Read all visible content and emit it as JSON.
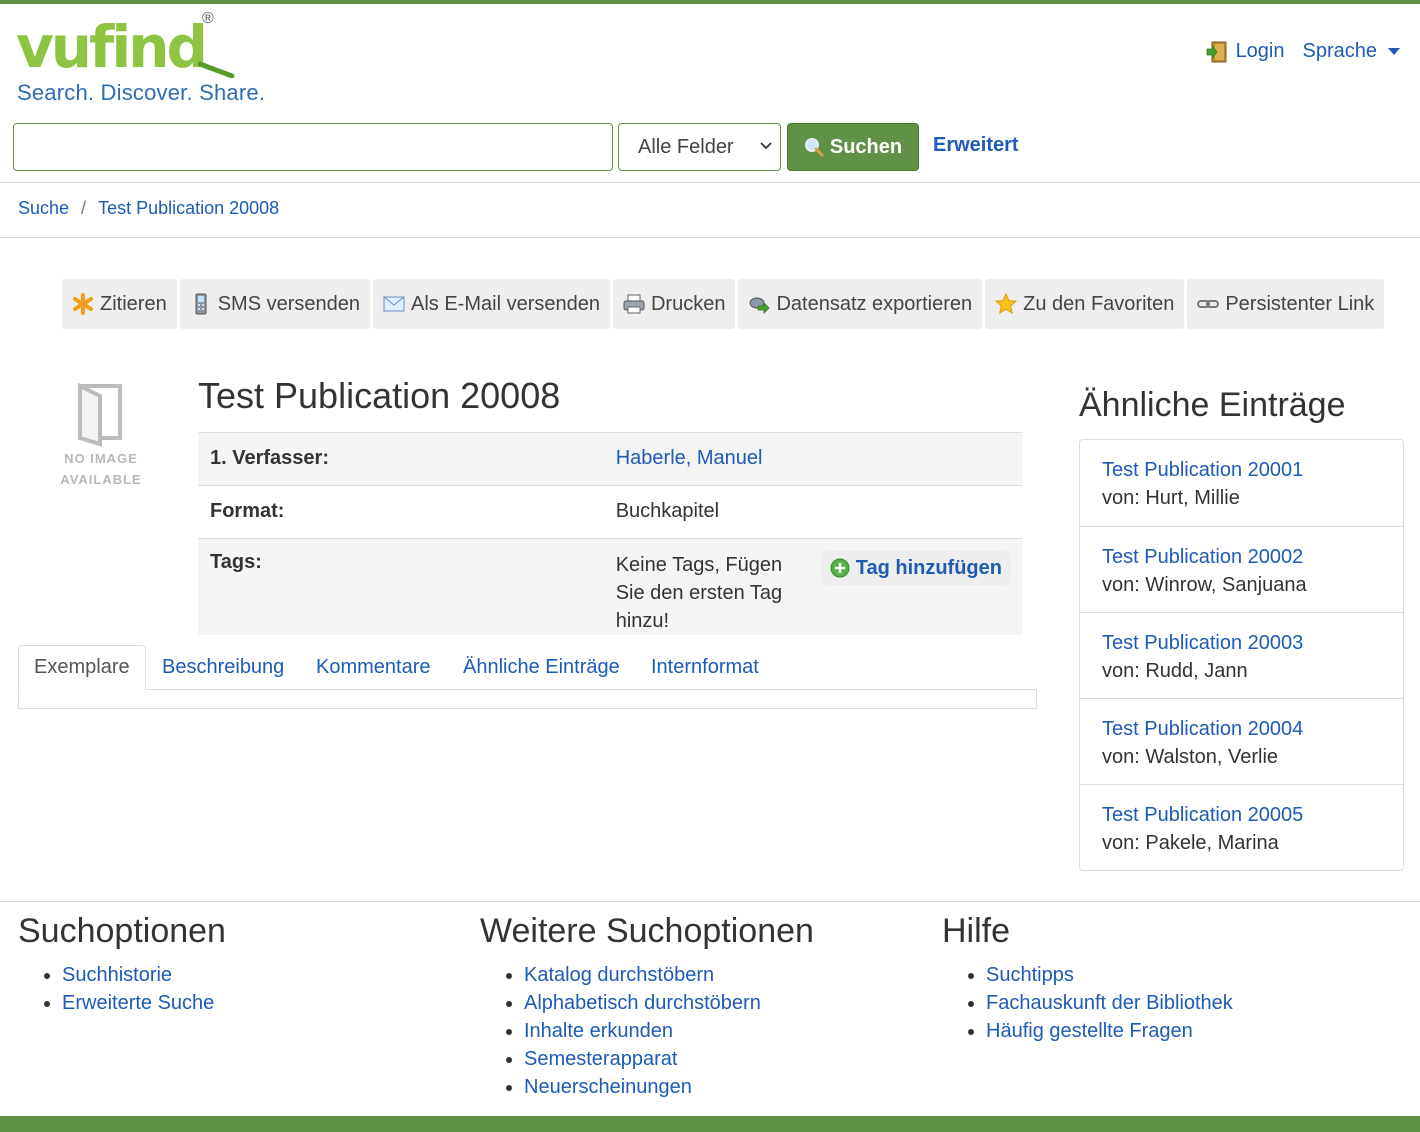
{
  "header": {
    "logo_word": "vufind",
    "logo_reg": "®",
    "logo_tagline": "Search. Discover. Share.",
    "login_label": "Login",
    "language_label": "Sprache"
  },
  "search": {
    "query": "",
    "field_selected": "Alle Felder",
    "submit_label": "Suchen",
    "advanced_label": "Erweitert"
  },
  "breadcrumb": {
    "items": [
      "Suche",
      "Test Publication 20008"
    ],
    "separator": "/"
  },
  "toolbar": {
    "items": [
      {
        "label": "Zitieren",
        "icon": "asterisk-icon"
      },
      {
        "label": "SMS versenden",
        "icon": "phone-icon"
      },
      {
        "label": "Als E-Mail versenden",
        "icon": "envelope-icon"
      },
      {
        "label": "Drucken",
        "icon": "printer-icon"
      },
      {
        "label": "Datensatz exportieren",
        "icon": "export-icon"
      },
      {
        "label": "Zu den Favoriten",
        "icon": "star-icon"
      },
      {
        "label": "Persistenter Link",
        "icon": "link-icon"
      }
    ]
  },
  "record": {
    "no_image_line1": "NO IMAGE",
    "no_image_line2": "AVAILABLE",
    "title": "Test Publication 20008",
    "fields": {
      "author_label": "1. Verfasser:",
      "author_value": "Haberle, Manuel",
      "format_label": "Format:",
      "format_value": "Buchkapitel",
      "tags_label": "Tags:",
      "tags_value": "Keine Tags, Fügen Sie den ersten Tag hinzu!",
      "add_tag_label": "Tag hinzufügen"
    }
  },
  "tabs": [
    {
      "label": "Exemplare",
      "active": true
    },
    {
      "label": "Beschreibung",
      "active": false
    },
    {
      "label": "Kommentare",
      "active": false
    },
    {
      "label": "Ähnliche Einträge",
      "active": false
    },
    {
      "label": "Internformat",
      "active": false
    }
  ],
  "similar": {
    "title": "Ähnliche Einträge",
    "items": [
      {
        "title": "Test Publication 20001",
        "by": "von: Hurt, Millie"
      },
      {
        "title": "Test Publication 20002",
        "by": "von: Winrow, Sanjuana"
      },
      {
        "title": "Test Publication 20003",
        "by": "von: Rudd, Jann"
      },
      {
        "title": "Test Publication 20004",
        "by": "von: Walston, Verlie"
      },
      {
        "title": "Test Publication 20005",
        "by": "von: Pakele, Marina"
      }
    ]
  },
  "footer": {
    "columns": [
      {
        "title": "Suchoptionen",
        "links": [
          "Suchhistorie",
          "Erweiterte Suche"
        ]
      },
      {
        "title": "Weitere Suchoptionen",
        "links": [
          "Katalog durchstöbern",
          "Alphabetisch durchstöbern",
          "Inhalte erkunden",
          "Semesterapparat",
          "Neuerscheinungen"
        ]
      },
      {
        "title": "Hilfe",
        "links": [
          "Suchtipps",
          "Fachauskunft der Bibliothek",
          "Häufig gestellte Fragen"
        ]
      }
    ]
  },
  "colors": {
    "brand_green": "#619144",
    "logo_green": "#8fc342",
    "link_blue": "#1d5bb5"
  }
}
